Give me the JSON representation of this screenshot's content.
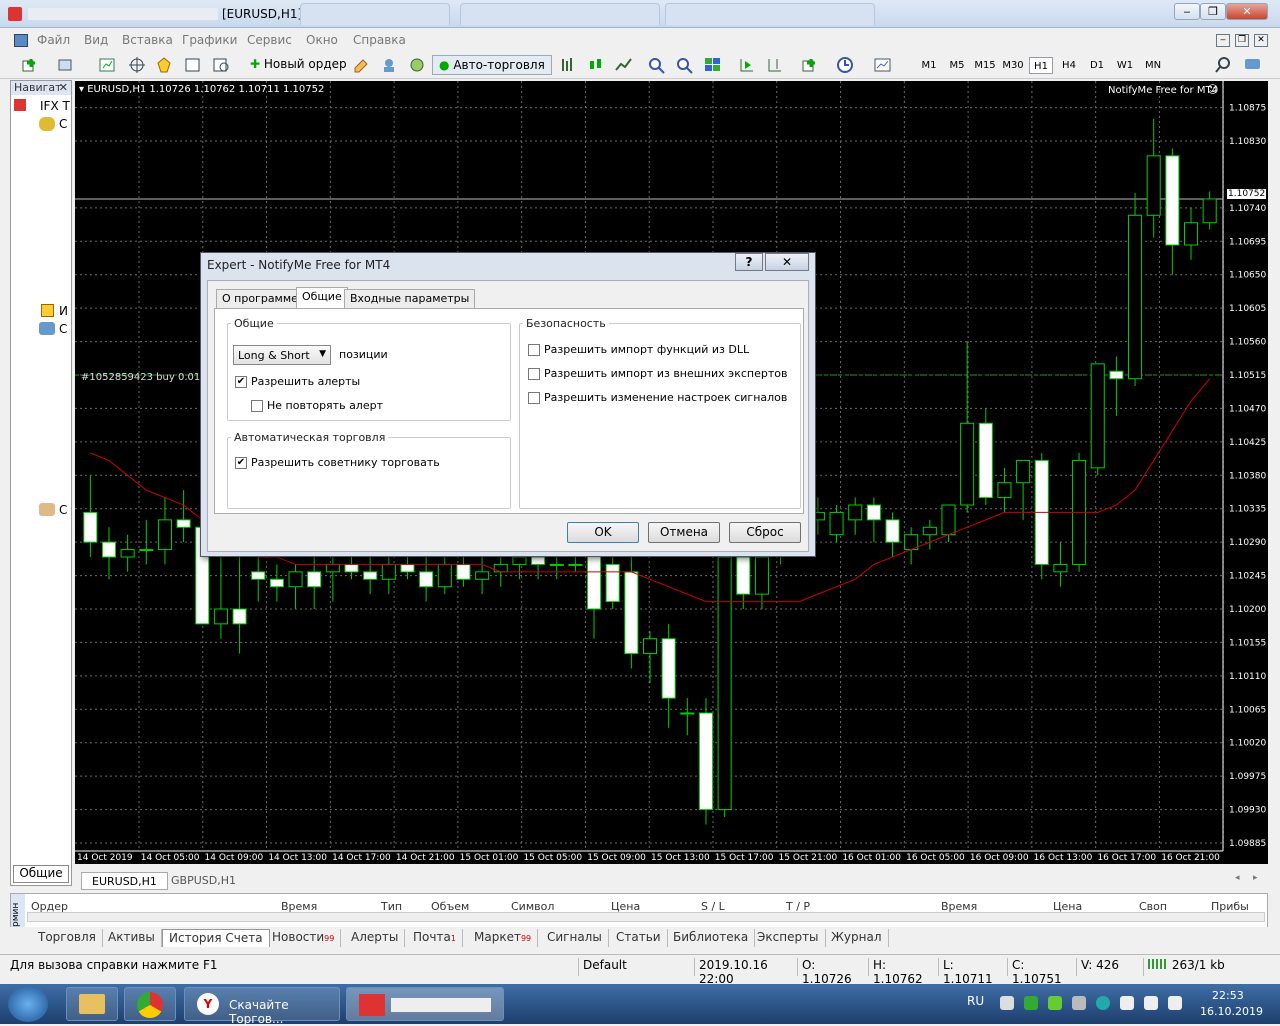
{
  "window": {
    "title": "[EURUSD,H1]",
    "btn_min": "‒",
    "btn_restore": "❐",
    "btn_close": "✕"
  },
  "menu": {
    "items": [
      "Файл",
      "Вид",
      "Вставка",
      "Графики",
      "Сервис",
      "Окно",
      "Справка"
    ]
  },
  "toolbar": {
    "new_order": "Новый ордер",
    "auto_trading": "Авто-торговля",
    "timeframes": [
      "M1",
      "M5",
      "M15",
      "M30",
      "H1",
      "H4",
      "D1",
      "W1",
      "MN"
    ],
    "active_tf": "H1"
  },
  "navigator": {
    "title": "Навигат",
    "close": "✕",
    "items": [
      "IFX T",
      "C",
      "И",
      "C",
      "C"
    ],
    "bottom_tab": "Общие"
  },
  "chart": {
    "symbol_header": "EURUSD,H1  1.10726 1.10762 1.10711 1.10752",
    "indicator_label": "NotifyMe Free for MT4",
    "order_label": "#1052859423 buy 0.01",
    "current_price": "1.10752",
    "price_ticks": [
      "1.10875",
      "1.10830",
      "1.10740",
      "1.10695",
      "1.10650",
      "1.10605",
      "1.10560",
      "1.10515",
      "1.10470",
      "1.10425",
      "1.10380",
      "1.10335",
      "1.10290",
      "1.10245",
      "1.10200",
      "1.10155",
      "1.10110",
      "1.10065",
      "1.10020",
      "1.09975",
      "1.09930",
      "1.09885"
    ],
    "time_ticks": [
      "14 Oct 2019",
      "14 Oct 05:00",
      "14 Oct 09:00",
      "14 Oct 13:00",
      "14 Oct 17:00",
      "14 Oct 21:00",
      "15 Oct 01:00",
      "15 Oct 05:00",
      "15 Oct 09:00",
      "15 Oct 13:00",
      "15 Oct 17:00",
      "15 Oct 21:00",
      "16 Oct 01:00",
      "16 Oct 05:00",
      "16 Oct 09:00",
      "16 Oct 13:00",
      "16 Oct 17:00",
      "16 Oct 21:00"
    ],
    "colors": {
      "bull": "#00d000",
      "bear": "#ffffff",
      "ma": "#d00000",
      "grid": "#6b6b6b"
    }
  },
  "chart_data": {
    "type": "candlestick",
    "ylim": [
      1.09885,
      1.109
    ],
    "candles": [
      [
        1.1033,
        1.1038,
        1.1027,
        1.1029
      ],
      [
        1.1029,
        1.1031,
        1.1024,
        1.1027
      ],
      [
        1.1027,
        1.103,
        1.1025,
        1.1028
      ],
      [
        1.1028,
        1.1032,
        1.1026,
        1.1028
      ],
      [
        1.1028,
        1.1035,
        1.1026,
        1.1032
      ],
      [
        1.1032,
        1.1036,
        1.1029,
        1.1031
      ],
      [
        1.1031,
        1.1034,
        1.1022,
        1.1018
      ],
      [
        1.1018,
        1.1028,
        1.1016,
        1.102
      ],
      [
        1.102,
        1.1029,
        1.1014,
        1.1018
      ],
      [
        1.1025,
        1.1027,
        1.1021,
        1.1024
      ],
      [
        1.1024,
        1.1026,
        1.1021,
        1.1023
      ],
      [
        1.1023,
        1.1026,
        1.102,
        1.1025
      ],
      [
        1.1025,
        1.1027,
        1.102,
        1.1023
      ],
      [
        1.1025,
        1.1028,
        1.1021,
        1.1026
      ],
      [
        1.1026,
        1.1028,
        1.1024,
        1.1025
      ],
      [
        1.1025,
        1.1027,
        1.1022,
        1.1024
      ],
      [
        1.1024,
        1.1028,
        1.1022,
        1.1026
      ],
      [
        1.1026,
        1.1028,
        1.1024,
        1.1025
      ],
      [
        1.1025,
        1.1027,
        1.1021,
        1.1023
      ],
      [
        1.1023,
        1.1027,
        1.1022,
        1.1026
      ],
      [
        1.1026,
        1.1028,
        1.1023,
        1.1024
      ],
      [
        1.1024,
        1.1027,
        1.1022,
        1.1025
      ],
      [
        1.1025,
        1.1027,
        1.1023,
        1.1026
      ],
      [
        1.1026,
        1.1028,
        1.1024,
        1.1027
      ],
      [
        1.1027,
        1.1028,
        1.1024,
        1.1026
      ],
      [
        1.1026,
        1.1028,
        1.1024,
        1.1026
      ],
      [
        1.1026,
        1.1027,
        1.1025,
        1.1026
      ],
      [
        1.1028,
        1.103,
        1.1016,
        1.102
      ],
      [
        1.1026,
        1.1028,
        1.102,
        1.1021
      ],
      [
        1.1025,
        1.1027,
        1.1012,
        1.1014
      ],
      [
        1.1014,
        1.1017,
        1.101,
        1.1016
      ],
      [
        1.1016,
        1.1018,
        1.1004,
        1.1008
      ],
      [
        1.1006,
        1.1008,
        1.1003,
        1.1006
      ],
      [
        1.1006,
        1.1008,
        1.0991,
        1.0993
      ],
      [
        1.0993,
        1.1028,
        1.0992,
        1.1027
      ],
      [
        1.1027,
        1.103,
        1.102,
        1.1022
      ],
      [
        1.1022,
        1.103,
        1.102,
        1.1027
      ],
      [
        1.103,
        1.1033,
        1.1026,
        1.1031
      ],
      [
        1.1031,
        1.1034,
        1.1028,
        1.1032
      ],
      [
        1.1032,
        1.1035,
        1.103,
        1.1033
      ],
      [
        1.103,
        1.1034,
        1.1029,
        1.1033
      ],
      [
        1.1032,
        1.1035,
        1.103,
        1.1034
      ],
      [
        1.1034,
        1.1035,
        1.1029,
        1.1032
      ],
      [
        1.1032,
        1.1033,
        1.1027,
        1.1029
      ],
      [
        1.1028,
        1.1031,
        1.1026,
        1.103
      ],
      [
        1.103,
        1.1032,
        1.1028,
        1.1031
      ],
      [
        1.103,
        1.1034,
        1.1029,
        1.1034
      ],
      [
        1.1034,
        1.1056,
        1.1033,
        1.1045
      ],
      [
        1.1045,
        1.1047,
        1.1034,
        1.1035
      ],
      [
        1.1035,
        1.1039,
        1.1033,
        1.1037
      ],
      [
        1.1037,
        1.104,
        1.1032,
        1.104
      ],
      [
        1.104,
        1.1041,
        1.1024,
        1.1026
      ],
      [
        1.1025,
        1.1029,
        1.1023,
        1.1026
      ],
      [
        1.1026,
        1.1041,
        1.1025,
        1.104
      ],
      [
        1.1039,
        1.1053,
        1.1038,
        1.1053
      ],
      [
        1.1052,
        1.1054,
        1.1046,
        1.1051
      ],
      [
        1.1051,
        1.1076,
        1.105,
        1.1073
      ],
      [
        1.1073,
        1.1086,
        1.107,
        1.1081
      ],
      [
        1.1081,
        1.1082,
        1.1065,
        1.1069
      ],
      [
        1.1069,
        1.1074,
        1.1067,
        1.1072
      ],
      [
        1.1072,
        1.10762,
        1.10711,
        1.10752
      ]
    ],
    "ma": [
      1.1041,
      1.104,
      1.1038,
      1.1036,
      1.1035,
      1.1034,
      1.1032,
      1.103,
      1.1028,
      1.1027,
      1.1027,
      1.1026,
      1.1026,
      1.1026,
      1.1026,
      1.1026,
      1.1026,
      1.1026,
      1.1026,
      1.1026,
      1.1026,
      1.1026,
      1.1025,
      1.1025,
      1.1025,
      1.1025,
      1.1025,
      1.1025,
      1.1025,
      1.1025,
      1.1024,
      1.1023,
      1.1022,
      1.1021,
      1.1021,
      1.1021,
      1.1021,
      1.1021,
      1.1021,
      1.1022,
      1.1023,
      1.1024,
      1.1026,
      1.1027,
      1.1028,
      1.1029,
      1.103,
      1.1031,
      1.1032,
      1.1033,
      1.1033,
      1.1033,
      1.1033,
      1.1033,
      1.1033,
      1.1034,
      1.1036,
      1.104,
      1.1044,
      1.1048,
      1.1051
    ]
  },
  "dialog": {
    "title": "Expert - NotifyMe Free for MT4",
    "help_btn": "?",
    "close_btn": "✕",
    "tabs": [
      "О программе",
      "Общие",
      "Входные параметры"
    ],
    "active_tab": "Общие",
    "general": {
      "group": "Общие",
      "select_value": "Long & Short",
      "select_suffix": "позиции",
      "allow_alerts": "Разрешить алерты",
      "no_repeat": "Не повторять алерт"
    },
    "auto": {
      "group": "Автоматическая торговля",
      "allow_trade": "Разрешить советнику торговать"
    },
    "security": {
      "group": "Безопасность",
      "dll": "Разрешить импорт функций из DLL",
      "ext": "Разрешить импорт из внешних экспертов",
      "signals": "Разрешить изменение настроек сигналов"
    },
    "buttons": {
      "ok": "OK",
      "cancel": "Отмена",
      "reset": "Сброс"
    }
  },
  "chart_tabs": [
    "EURUSD,H1",
    "GBPUSD,H1"
  ],
  "terminal": {
    "side_label": "Термин",
    "headers": [
      "Ордер",
      "Время",
      "Тип",
      "Объем",
      "Символ",
      "Цена",
      "S / L",
      "T / P",
      "Время",
      "Цена",
      "Своп",
      "Прибы"
    ],
    "tabs": [
      {
        "label": "Торговля",
        "badge": ""
      },
      {
        "label": "Активы",
        "badge": ""
      },
      {
        "label": "История Счета",
        "badge": ""
      },
      {
        "label": "Новости",
        "badge": "99"
      },
      {
        "label": "Алерты",
        "badge": ""
      },
      {
        "label": "Почта",
        "badge": "1"
      },
      {
        "label": "Маркет",
        "badge": "99"
      },
      {
        "label": "Сигналы",
        "badge": ""
      },
      {
        "label": "Статьи",
        "badge": ""
      },
      {
        "label": "Библиотека",
        "badge": ""
      },
      {
        "label": "Эксперты",
        "badge": ""
      },
      {
        "label": "Журнал",
        "badge": ""
      }
    ],
    "active_tab": "История Счета"
  },
  "status": {
    "help": "Для вызова справки нажмите F1",
    "profile": "Default",
    "datetime": "2019.10.16 22:00",
    "open": "O: 1.10726",
    "high": "H: 1.10762",
    "low": "L: 1.10711",
    "close": "C: 1.10751",
    "volume": "V: 426",
    "traffic": "263/1 kb"
  },
  "taskbar": {
    "item1": "Скачайте Торгов...",
    "lang": "RU",
    "time": "22:53",
    "date": "16.10.2019"
  }
}
